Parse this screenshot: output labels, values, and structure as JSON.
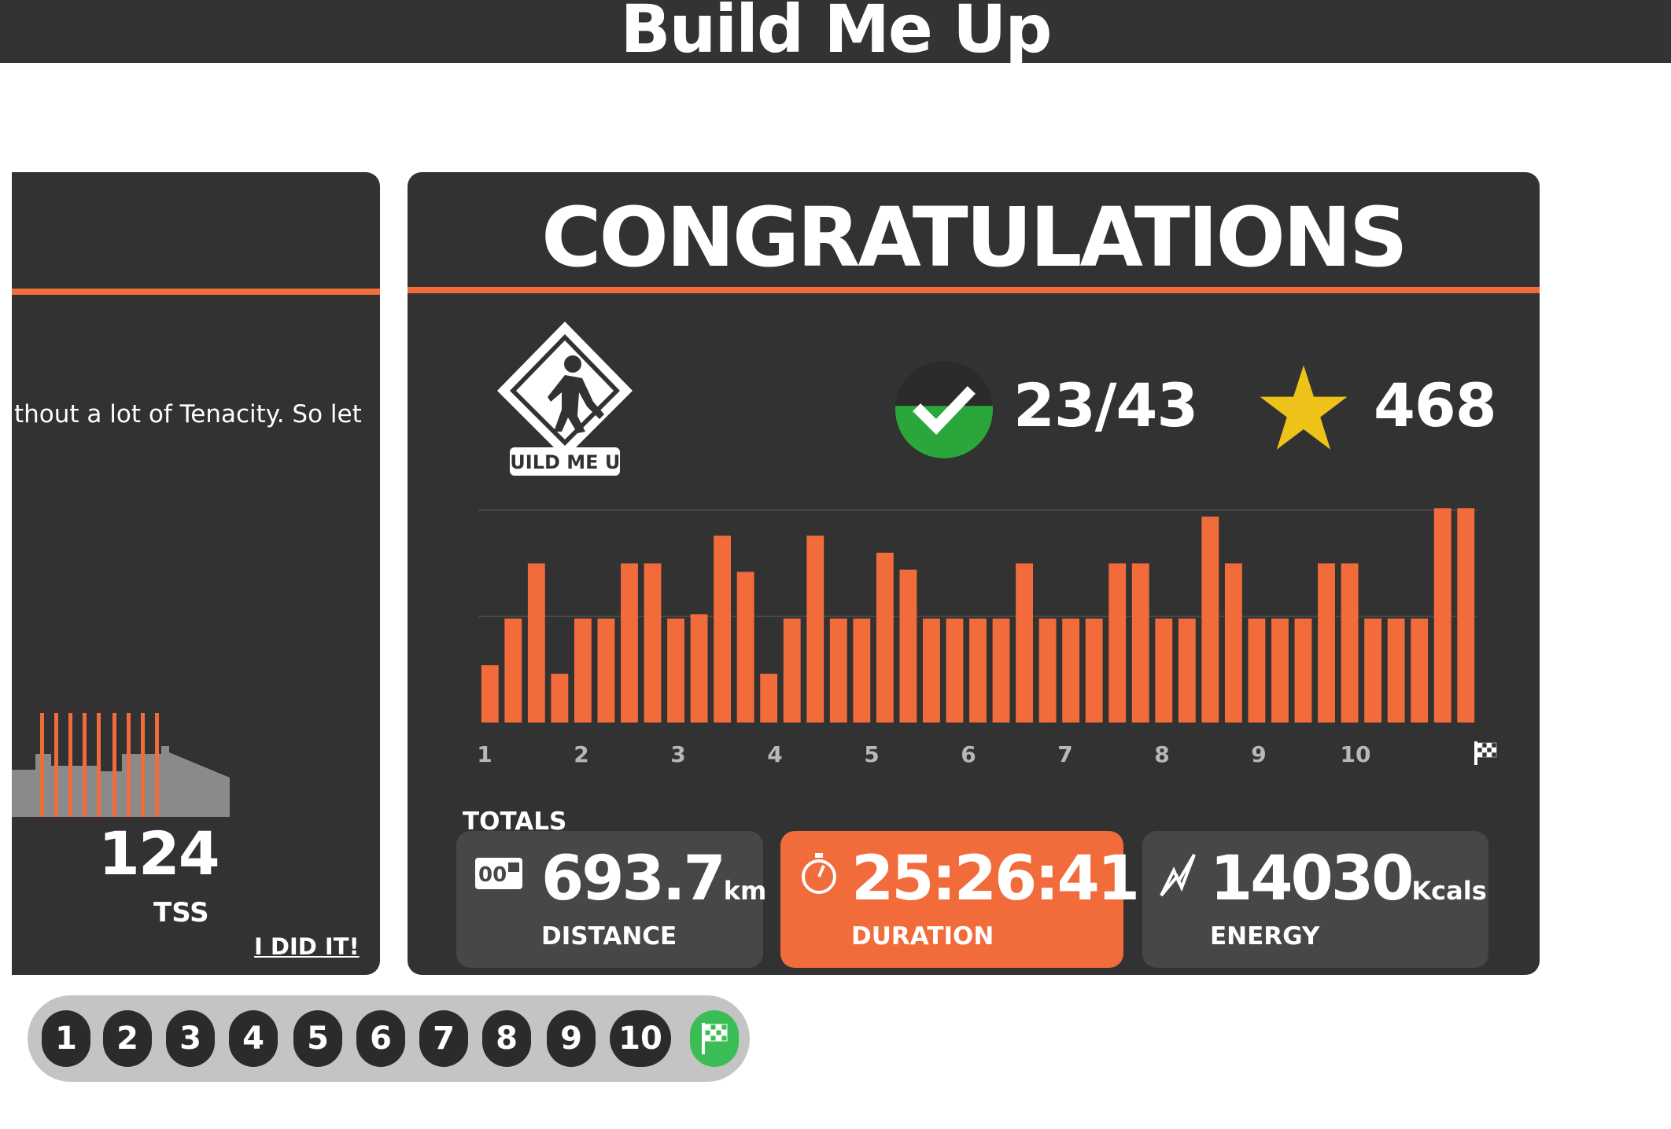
{
  "page_title": "Build Me Up",
  "colors": {
    "accent": "#f26b3a",
    "panel": "#323232",
    "success": "#2aa63a",
    "star": "#efc21a"
  },
  "left_panel": {
    "description_fragment": "thout a lot of Tenacity. So let",
    "tss_value": "124",
    "tss_label": "TSS",
    "done_link": "I DID IT!"
  },
  "main_panel": {
    "heading": "CONGRATULATIONS",
    "badge_label": "BUILD ME UP",
    "badge_icon": "construction-worker-sign-icon",
    "progress": "23/43",
    "progress_fraction": 0.535,
    "stars": "468",
    "totals_label": "TOTALS",
    "stats": {
      "distance": {
        "value": "693.7",
        "unit": "km",
        "label": "DISTANCE",
        "icon": "odometer-icon"
      },
      "duration": {
        "value": "25:26:41",
        "label": "DURATION",
        "icon": "stopwatch-icon"
      },
      "energy": {
        "value": "14030",
        "unit": "Kcals",
        "label": "ENERGY",
        "icon": "lightning-icon"
      }
    }
  },
  "chart_data": {
    "type": "bar",
    "x_ticks": [
      "1",
      "2",
      "3",
      "4",
      "5",
      "6",
      "7",
      "8",
      "9",
      "10"
    ],
    "end_marker": "finish-flag-icon",
    "grid": true,
    "ylim": [
      0,
      100
    ],
    "values": [
      27,
      49,
      75,
      23,
      49,
      49,
      75,
      75,
      49,
      51,
      88,
      71,
      23,
      49,
      88,
      49,
      49,
      80,
      72,
      49,
      49,
      49,
      49,
      75,
      49,
      49,
      49,
      75,
      75,
      49,
      49,
      97,
      75,
      49,
      49,
      49,
      75,
      75,
      49,
      49,
      49,
      101,
      101
    ]
  },
  "nav": {
    "items": [
      "1",
      "2",
      "3",
      "4",
      "5",
      "6",
      "7",
      "8",
      "9",
      "10"
    ],
    "finish_icon": "finish-flag-icon"
  }
}
